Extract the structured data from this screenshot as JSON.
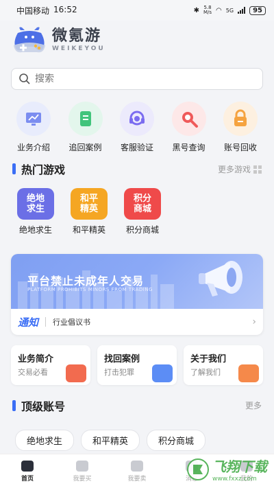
{
  "status_bar": {
    "carrier": "中国移动",
    "time": "16:52",
    "network_speed": "5.8\nM/s",
    "network_type": "5G",
    "battery": "95"
  },
  "app": {
    "name_cn": "微氪游",
    "name_en": "WEIKEYOU"
  },
  "search": {
    "placeholder": "搜索"
  },
  "quick_actions": [
    {
      "label": "业务介绍",
      "icon": "chart-screen-icon",
      "color": "#7b8df0",
      "bg": "#e8ecfc"
    },
    {
      "label": "追回案例",
      "icon": "document-icon",
      "color": "#41c47b",
      "bg": "#e3f6ec"
    },
    {
      "label": "客服验证",
      "icon": "headset-icon",
      "color": "#7b6cf0",
      "bg": "#eceafc"
    },
    {
      "label": "黑号查询",
      "icon": "magnifier-icon",
      "color": "#ef5a5a",
      "bg": "#fde8e8"
    },
    {
      "label": "账号回收",
      "icon": "lock-icon",
      "color": "#f5a340",
      "bg": "#fdf0e0"
    }
  ],
  "hot_games": {
    "title": "热门游戏",
    "more": "更多游戏",
    "items": [
      {
        "tile_text": "绝地\n求生",
        "label": "绝地求生",
        "color": "#6b6fe6"
      },
      {
        "tile_text": "和平\n精英",
        "label": "和平精英",
        "color": "#f5a623"
      },
      {
        "tile_text": "积分\n商城",
        "label": "积分商城",
        "color": "#ef4a4a"
      }
    ]
  },
  "banner": {
    "title": "平台禁止未成年人交易",
    "subtitle": "PLATFORM PROHIBITS MINORS FROM TRADING",
    "notice_tag": "通知",
    "notice_text": "行业倡议书"
  },
  "info_cards": [
    {
      "title": "业务简介",
      "sub": "交易必看",
      "color": "#f26b4f"
    },
    {
      "title": "找回案例",
      "sub": "打击犯罪",
      "color": "#5c8df5"
    },
    {
      "title": "关于我们",
      "sub": "了解我们",
      "color": "#f5894a"
    }
  ],
  "top_accounts": {
    "title": "顶级账号",
    "more": "更多",
    "tags": [
      "绝地求生",
      "和平精英",
      "积分商城"
    ]
  },
  "bottom_nav": [
    {
      "label": "首页",
      "active": true
    },
    {
      "label": "我要买",
      "active": false
    },
    {
      "label": "我要卖",
      "active": false
    },
    {
      "label": "消息",
      "active": false
    },
    {
      "label": "我的",
      "active": false
    }
  ],
  "watermark": {
    "text": "飞翔下载",
    "url": "www.fxxz.com"
  },
  "colors": {
    "accent": "#3b6ef5",
    "background": "#f3f4f7"
  }
}
